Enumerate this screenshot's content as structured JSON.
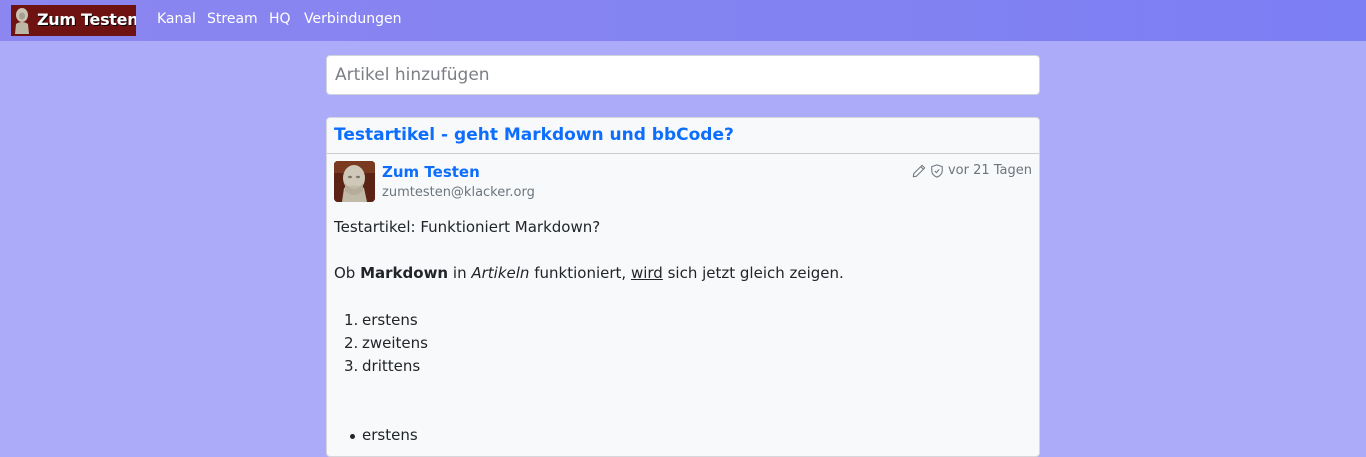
{
  "navbar": {
    "brand_text": "Zum Testen",
    "links": [
      "Kanal",
      "Stream",
      "HQ",
      "Verbindungen"
    ]
  },
  "composer": {
    "placeholder": "Artikel hinzufügen"
  },
  "article": {
    "title": "Testartikel - geht Markdown und bbCode?",
    "author_name": "Zum Testen",
    "author_address": "zumtesten@klacker.org",
    "timestamp": "vor 21 Tagen",
    "intro": "Testartikel: Funktioniert Markdown?",
    "sentence": {
      "w1": "Ob",
      "bold": "Markdown",
      "w2": "in",
      "italic": "Artikeln",
      "w3": "funktioniert,",
      "underline": "wird",
      "w4": "sich jetzt gleich zeigen."
    },
    "ordered_list": [
      "erstens",
      "zweitens",
      "drittens"
    ],
    "ordered_numbers": [
      "1.",
      "2.",
      "3."
    ],
    "unordered_list": [
      "erstens"
    ]
  },
  "colors": {
    "page_bg": "#ababf9",
    "navbar_bg": "#8483f2",
    "link_blue": "#0d6efd",
    "brand_bg": "#6e1212"
  },
  "icons": {
    "edit": "pencil-icon",
    "privacy": "shield-icon"
  }
}
